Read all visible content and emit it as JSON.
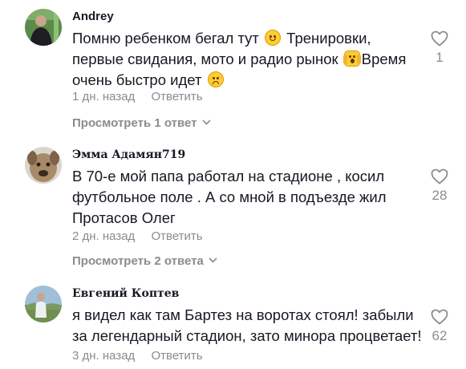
{
  "comments": [
    {
      "username": "Andrey",
      "lines": [
        {
          "a": "Помню ребенком бегал тут",
          "emoji": "slightly-smiling-face",
          "b": " Тренировки,"
        },
        {
          "a": "первые свидания, мото и радио рынок",
          "emoji": "face-screaming-in-fear",
          "b": "Время"
        },
        {
          "a": "очень быстро идет",
          "emoji": "frowning-face",
          "b": ""
        }
      ],
      "time": "1 дн. назад",
      "reply_label": "Ответить",
      "view_replies": "Просмотреть 1 ответ",
      "likes": "1",
      "avatar": "person-in-dark-clothes-on-green-field"
    },
    {
      "username": "Эмма Адамян719",
      "lines": [
        {
          "a": "В 70-е мой папа работал на стадионе , косил"
        },
        {
          "a": "футбольное поле . А со мной в подъезде жил"
        },
        {
          "a": "Протасов Олег"
        }
      ],
      "time": "2 дн. назад",
      "reply_label": "Ответить",
      "view_replies": "Просмотреть 2 ответа",
      "likes": "28",
      "avatar": "brown-dog-face"
    },
    {
      "username": "Евгений Коптев",
      "lines": [
        {
          "a": "я видел как там Бартез на воротах стоял! забыли"
        },
        {
          "a": "за легендарный стадион, зато минора процветает!"
        }
      ],
      "time": "3 дн. назад",
      "reply_label": "Ответить",
      "likes": "62",
      "avatar": "person-outdoors-landscape"
    }
  ],
  "colors": {
    "text": "#161823",
    "muted": "#8a8b91"
  },
  "icons": {
    "like": "heart-outline-icon",
    "expand": "chevron-down-icon"
  }
}
